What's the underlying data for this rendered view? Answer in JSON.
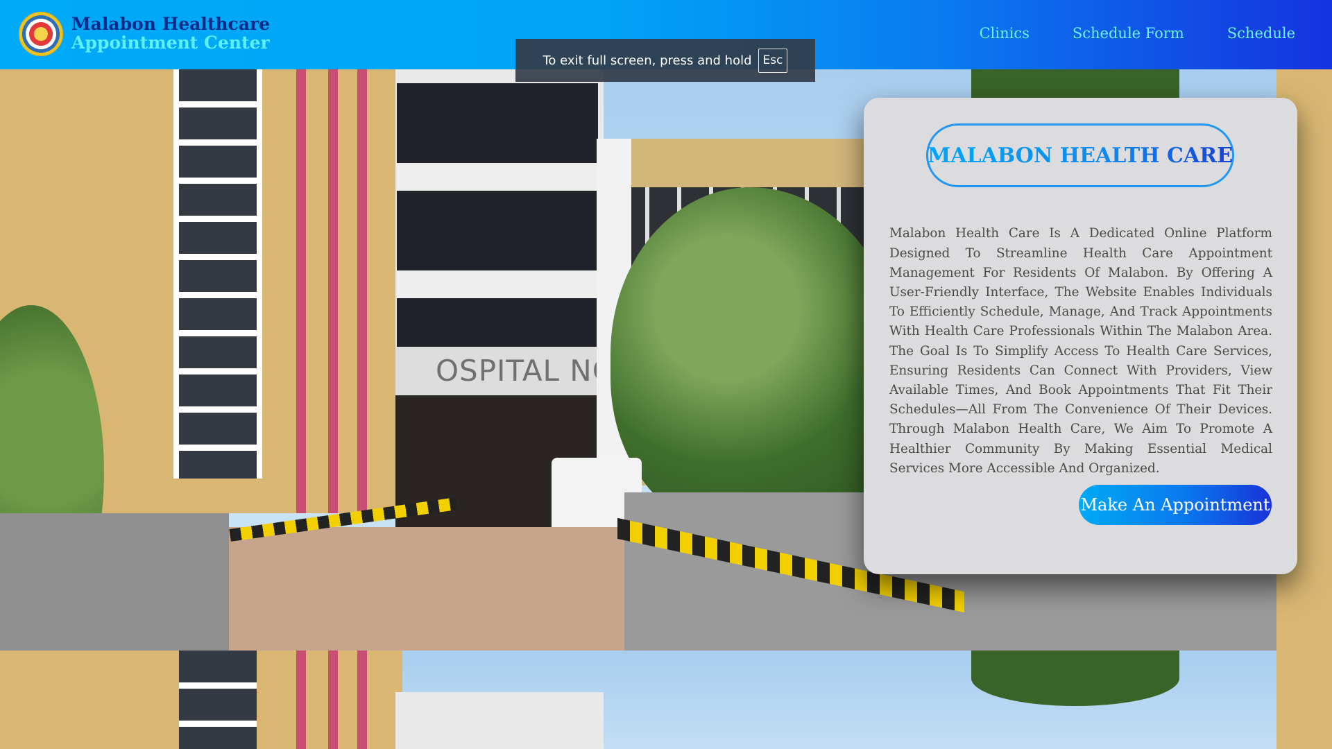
{
  "header": {
    "brand_line1": "Malabon Healthcare",
    "brand_line2": "Appointment Center",
    "nav": [
      "Clinics",
      "Schedule Form",
      "Schedule"
    ]
  },
  "fullscreen_notice": {
    "text": "To exit full screen, press and hold",
    "key": "Esc"
  },
  "hero": {
    "building_sign": "OSPITAL NG"
  },
  "card": {
    "title": "MALABON HEALTH CARE",
    "description": "Malabon Health Care Is A Dedicated Online Platform Designed To Streamline Health Care Appointment Management For Residents Of Malabon. By Offering A User-Friendly Interface, The Website Enables Individuals To Efficiently Schedule, Manage, And Track Appointments With Health Care Professionals Within The Malabon Area. The Goal Is To Simplify Access To Health Care Services, Ensuring Residents Can Connect With Providers, View Available Times, And Book Appointments That Fit Their Schedules—All From The Convenience Of Their Devices. Through Malabon Health Care, We Aim To Promote A Healthier Community By Making Essential Medical Services More Accessible And Organized.",
    "cta_label": "Make An Appointment"
  },
  "colors": {
    "header_start": "#00aaf8",
    "header_end": "#1533e0",
    "brand_dark": "#0a2a8a",
    "brand_light": "#5ef0ff",
    "nav_text": "#6ff3ff",
    "card_bg": "#dcdbdd",
    "pill_border": "#2196f3"
  }
}
